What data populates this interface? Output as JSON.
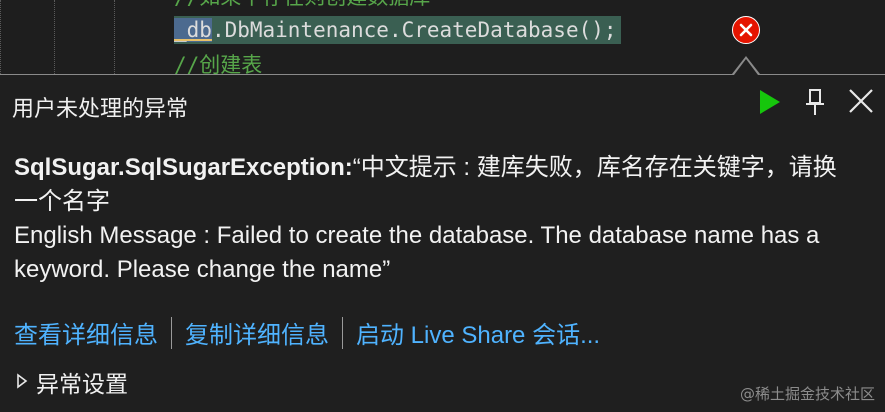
{
  "editor": {
    "line_cut": "//如果不存在则创建数据库",
    "line_current_db": "_db",
    "line_current_rest": ".DbMaintenance.CreateDatabase();",
    "line_next": "//创建表"
  },
  "popup": {
    "title": "用户未处理的异常",
    "exception_type": "SqlSugar.SqlSugarException:",
    "message_line_cn": "“中文提示 : 建库失败，库名存在关键字，请换一个名字",
    "message_line_en": "English Message : Failed to create the database. The database name has a keyword. Please change the name”",
    "links": {
      "view_details": "查看详细信息",
      "copy_details": "复制详细信息",
      "live_share": "启动 Live Share 会话..."
    },
    "settings_label": "异常设置"
  },
  "watermark": "@稀土掘金技术社区",
  "colors": {
    "accent_link": "#4fb3ff",
    "play_green": "#16c60c",
    "error_red": "#e51400",
    "comment_green": "#57a64a"
  },
  "icons": {
    "continue": "play-icon",
    "pin": "pin-icon",
    "close": "close-icon",
    "error": "error-icon",
    "expand": "chevron-right-icon"
  }
}
